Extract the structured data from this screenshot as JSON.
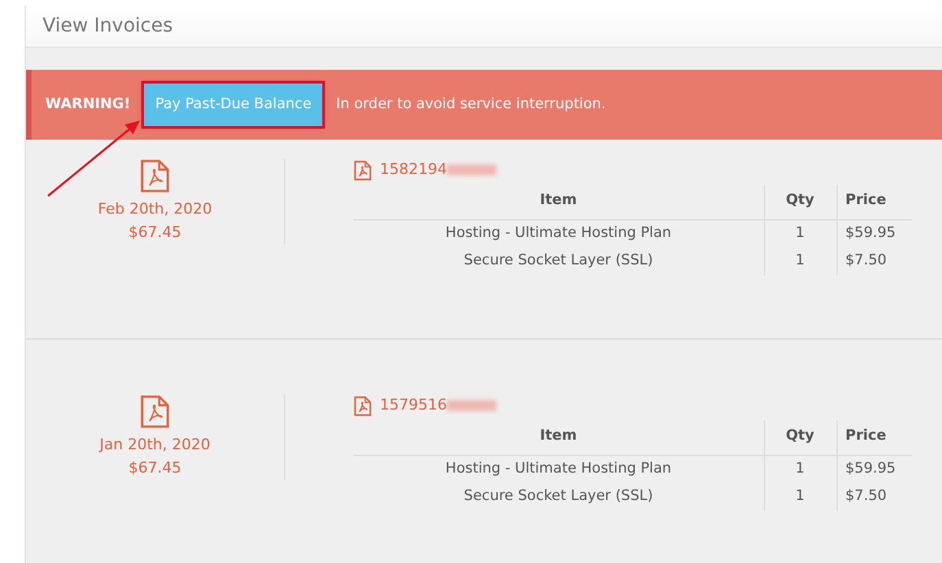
{
  "panel": {
    "title": "View Invoices"
  },
  "alert": {
    "label": "WARNING!",
    "button": "Pay Past-Due Balance",
    "message": "In order to avoid service interruption.",
    "button_highlighted": true
  },
  "invoices": [
    {
      "date": "Feb 20th, 2020",
      "amount": "$67.45",
      "number": "1582194",
      "columns": [
        "Item",
        "Qty",
        "Price"
      ],
      "rows": [
        [
          "Hosting - Ultimate Hosting Plan",
          "1",
          "$59.95"
        ],
        [
          "Secure Socket Layer (SSL)",
          "1",
          "$7.50"
        ]
      ]
    },
    {
      "date": "Jan 20th, 2020",
      "amount": "$67.45",
      "number": "1579516",
      "columns": [
        "Item",
        "Qty",
        "Price"
      ],
      "rows": [
        [
          "Hosting - Ultimate Hosting Plan",
          "1",
          "$59.95"
        ],
        [
          "Secure Socket Layer (SSL)",
          "1",
          "$7.50"
        ]
      ]
    }
  ]
}
